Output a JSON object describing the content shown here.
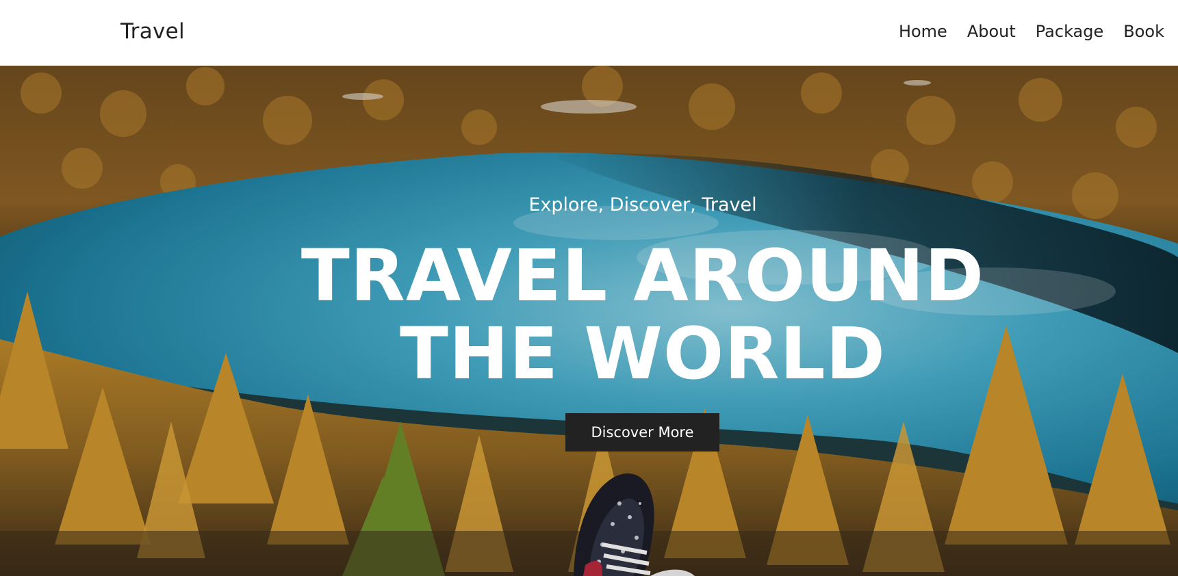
{
  "nav": {
    "brand": "Travel",
    "links": [
      {
        "label": "Home"
      },
      {
        "label": "About"
      },
      {
        "label": "Package"
      },
      {
        "label": "Book"
      }
    ]
  },
  "hero": {
    "tagline": "Explore, Discover, Travel",
    "headline_line1": "TRAVEL AROUND",
    "headline_line2": "THE WORLD",
    "cta_label": "Discover More"
  },
  "colors": {
    "nav_bg": "#ffffff",
    "text_dark": "#222222",
    "button_bg": "#222222",
    "hero_text": "#ffffff",
    "lake": "#2a8fae",
    "forest": "#c08b2a"
  }
}
